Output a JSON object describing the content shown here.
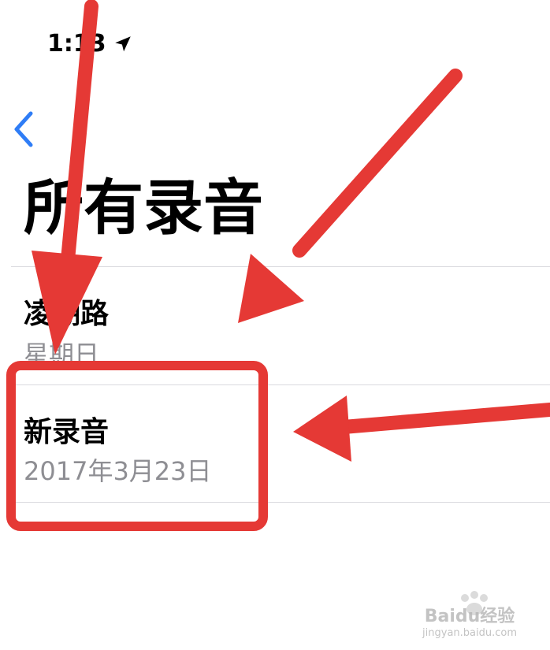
{
  "status_bar": {
    "time": "1:13",
    "location_icon": "location-arrow-icon"
  },
  "nav": {
    "back_icon": "chevron-left-icon"
  },
  "page": {
    "title": "所有录音"
  },
  "recordings": [
    {
      "name": "凌湖路",
      "date": "星期日"
    },
    {
      "name": "新录音",
      "date": "2017年3月23日"
    }
  ],
  "watermark": {
    "brand": "Baidu经验",
    "url": "jingyan.baidu.com"
  },
  "colors": {
    "accent_blue": "#2f7df6",
    "annotation_red": "#e53935",
    "secondary_text": "#8e8e93",
    "divider": "#d9d9de"
  }
}
